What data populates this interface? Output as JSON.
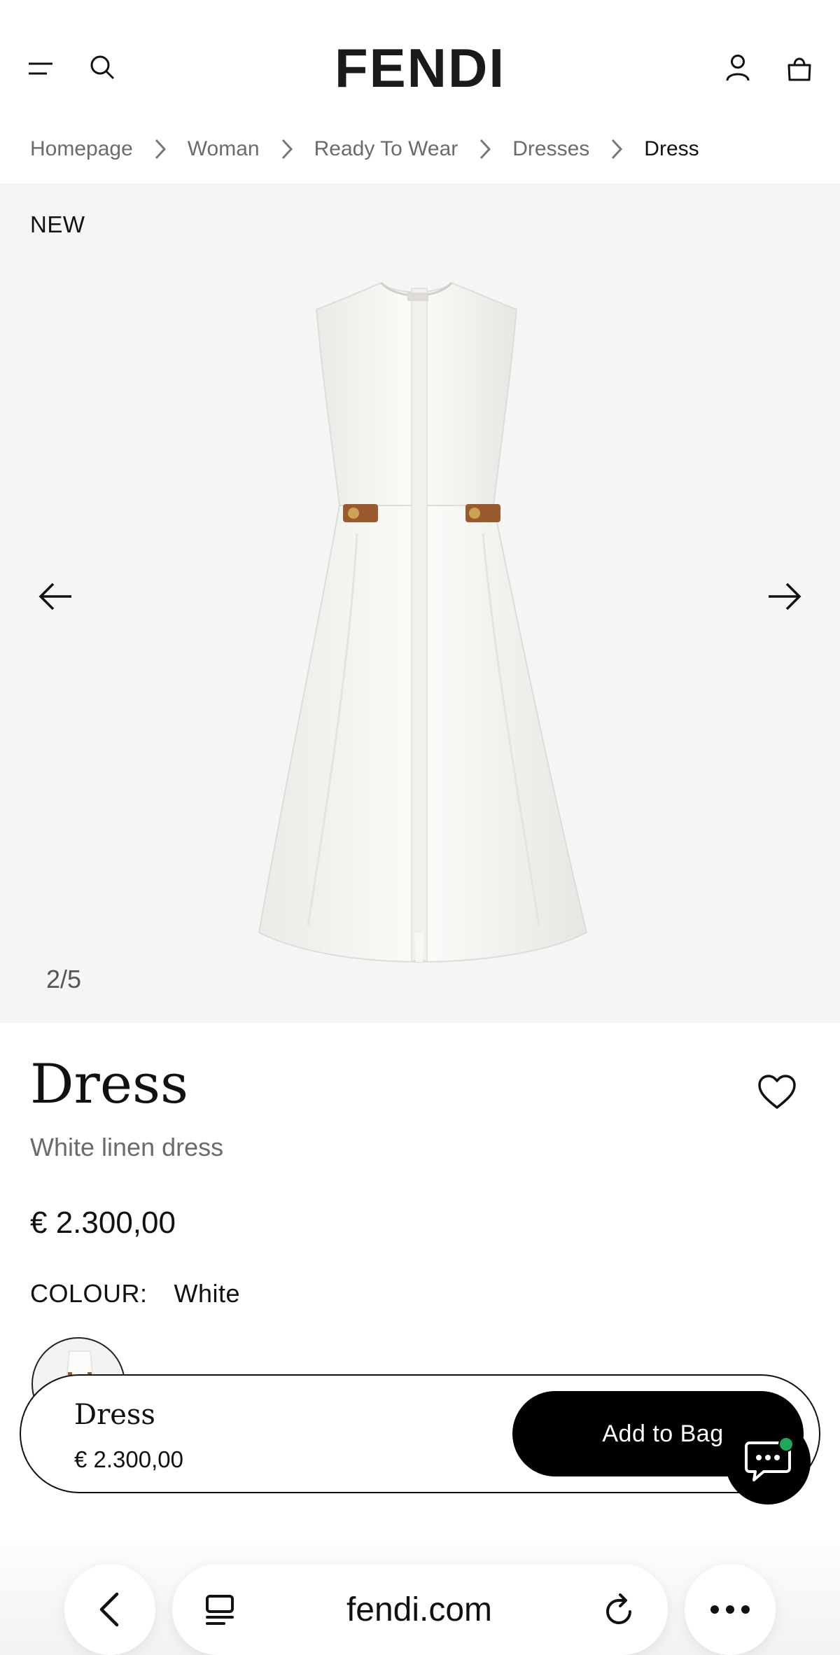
{
  "header": {
    "brand": "FENDI",
    "icons": [
      "menu-icon",
      "search-icon",
      "account-icon",
      "bag-icon"
    ]
  },
  "breadcrumb": {
    "items": [
      "Homepage",
      "Woman",
      "Ready To Wear",
      "Dresses",
      "Dress"
    ]
  },
  "gallery": {
    "badge": "NEW",
    "counter": "2/5"
  },
  "product": {
    "title": "Dress",
    "subtitle": "White linen dress",
    "price": "€ 2.300,00",
    "colour_label": "COLOUR:",
    "colour_value": "White"
  },
  "sticky_bar": {
    "title": "Dress",
    "price": "€ 2.300,00",
    "add_to_bag": "Add to Bag"
  },
  "browser": {
    "url": "fendi.com"
  },
  "colors": {
    "gallery_bg": "#f5f5f5",
    "primary": "#000000",
    "chat_status": "#1fa85b"
  }
}
